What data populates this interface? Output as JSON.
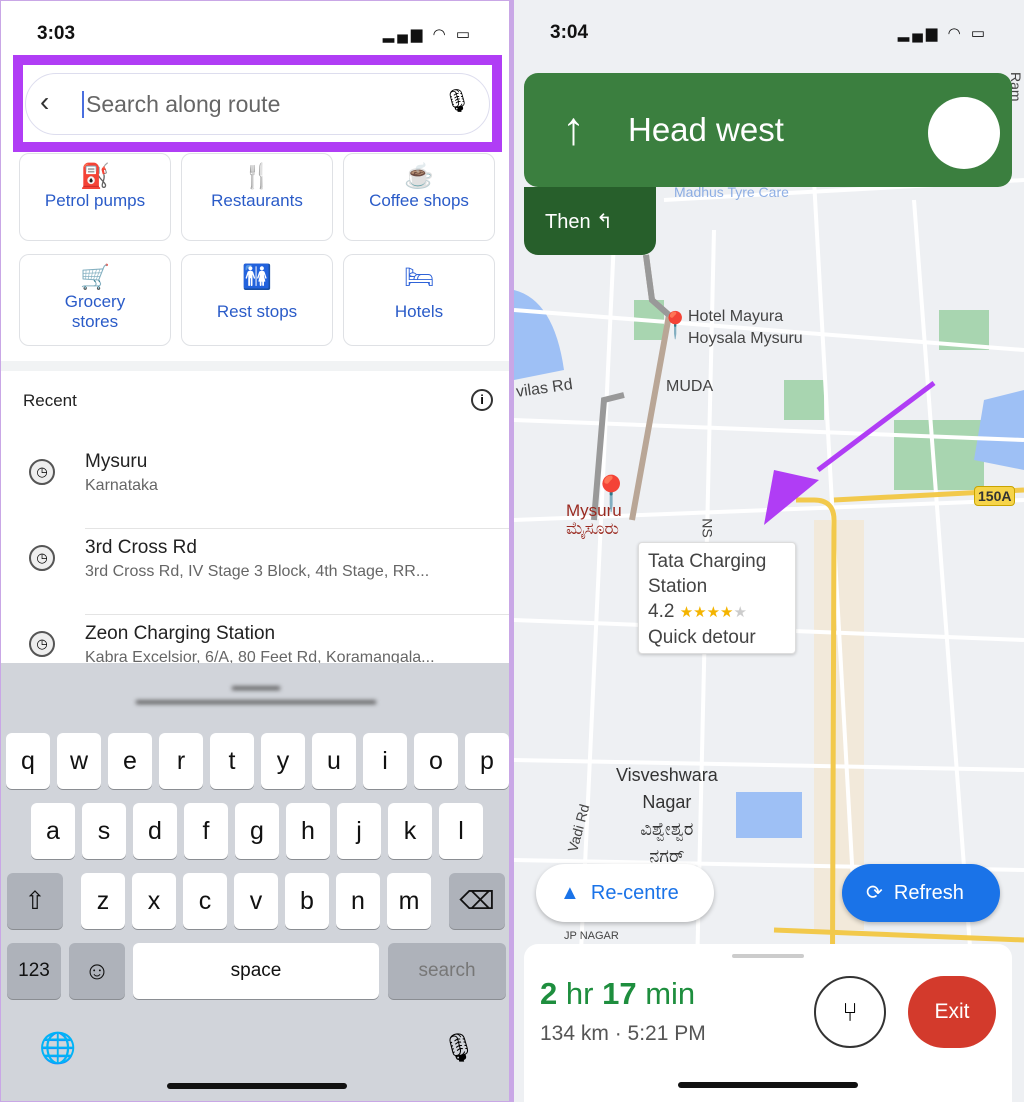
{
  "left": {
    "status": {
      "time": "3:03"
    },
    "search": {
      "placeholder": "Search along route"
    },
    "categories": [
      {
        "label": "Petrol pumps",
        "icon": "gas-station-icon"
      },
      {
        "label": "Restaurants",
        "icon": "restaurant-icon"
      },
      {
        "label": "Coffee shops",
        "icon": "coffee-icon"
      },
      {
        "label": "Grocery stores",
        "icon": "cart-icon"
      },
      {
        "label": "Rest stops",
        "icon": "restroom-icon"
      },
      {
        "label": "Hotels",
        "icon": "bed-icon"
      }
    ],
    "recent_label": "Recent",
    "recent": [
      {
        "title": "Mysuru",
        "subtitle": "Karnataka"
      },
      {
        "title": "3rd Cross Rd",
        "subtitle": "3rd Cross Rd, IV Stage 3 Block, 4th Stage, RR..."
      },
      {
        "title": "Zeon Charging Station",
        "subtitle": "Kabra Excelsior, 6/A, 80 Feet Rd, Koramangala..."
      }
    ],
    "keyboard": {
      "row1": [
        "q",
        "w",
        "e",
        "r",
        "t",
        "y",
        "u",
        "i",
        "o",
        "p"
      ],
      "row2": [
        "a",
        "s",
        "d",
        "f",
        "g",
        "h",
        "j",
        "k",
        "l"
      ],
      "row3": [
        "z",
        "x",
        "c",
        "v",
        "b",
        "n",
        "m"
      ],
      "numbers": "123",
      "space": "space",
      "search": "search"
    }
  },
  "right": {
    "status": {
      "time": "3:04"
    },
    "instruction": "Head west",
    "then": "Then",
    "map_labels": {
      "tyre": "Madhus Tyre Care",
      "hotel1": "Hotel Mayura",
      "hotel2": "Hoysala Mysuru",
      "muda": "MUDA",
      "vilas": "vilas Rd",
      "mysuru": "Mysuru",
      "mysuru_kn": "ಮೈಸೂರು",
      "ns": "NS",
      "hw": "150A",
      "area1": "Visveshwara",
      "area2": "Nagar",
      "area_kn1": "ವಿಶ್ವೇಶ್ವರ",
      "area_kn2": "ನಗರ್",
      "road": "Vadi Rd",
      "jp": "JP NAGAR",
      "ram": "Ram"
    },
    "popup": {
      "name1": "Tata Charging",
      "name2": "Station",
      "rating": "4.2",
      "stars": "★★★★",
      "star_empty": "★",
      "detour": "Quick detour",
      "rating_value": 4.2
    },
    "recentre": "Re-centre",
    "refresh": "Refresh",
    "eta": {
      "h": "2",
      "hl": "hr",
      "m": "17",
      "ml": "min"
    },
    "distance": "134 km · 5:21 PM",
    "exit": "Exit",
    "colors": {
      "nav": "#3b7f3f",
      "refresh": "#1a73e8",
      "exit": "#d33a2c",
      "highlight": "#b03df5"
    }
  }
}
